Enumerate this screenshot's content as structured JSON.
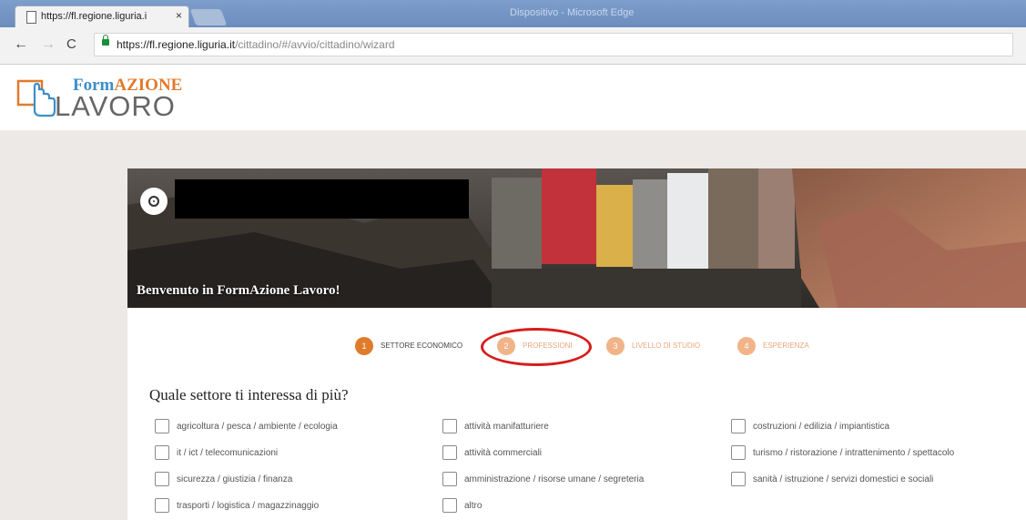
{
  "browser": {
    "tab_title": "https://fl.regione.liguria.i",
    "tab_close": "×",
    "window_title": "Dispositivo - Microsoft Edge",
    "url_host": "https://fl.regione.liguria.it",
    "url_path": "/cittadino/#/avvio/cittadino/wizard",
    "back": "←",
    "forward": "→",
    "reload": "C"
  },
  "brand": {
    "form": "Form",
    "azione": "AZIONE",
    "lavoro": "LAVORO"
  },
  "banner": {
    "welcome": "Benvenuto in FormAzione Lavoro!"
  },
  "steps": [
    {
      "num": "1",
      "label": "SETTORE ECONOMICO"
    },
    {
      "num": "2",
      "label": "PROFESSIONI"
    },
    {
      "num": "3",
      "label": "LIVELLO DI STUDIO"
    },
    {
      "num": "4",
      "label": "ESPERIENZA"
    }
  ],
  "question": "Quale settore ti interessa di più?",
  "options": [
    "agricoltura / pesca / ambiente / ecologia",
    "attività manifatturiere",
    "costruzioni / edilizia / impiantistica",
    "it / ict / telecomunicazioni",
    "attività commerciali",
    "turismo / ristorazione / intrattenimento / spettacolo",
    "sicurezza / giustizia / finanza",
    "amministrazione / risorse umane / segreteria",
    "sanità / istruzione / servizi domestici e sociali",
    "trasporti / logistica / magazzinaggio",
    "altro"
  ],
  "colors": {
    "accent_orange": "#e07b2c",
    "accent_blue": "#3c8fc8",
    "highlight_red": "#d81c1c"
  }
}
